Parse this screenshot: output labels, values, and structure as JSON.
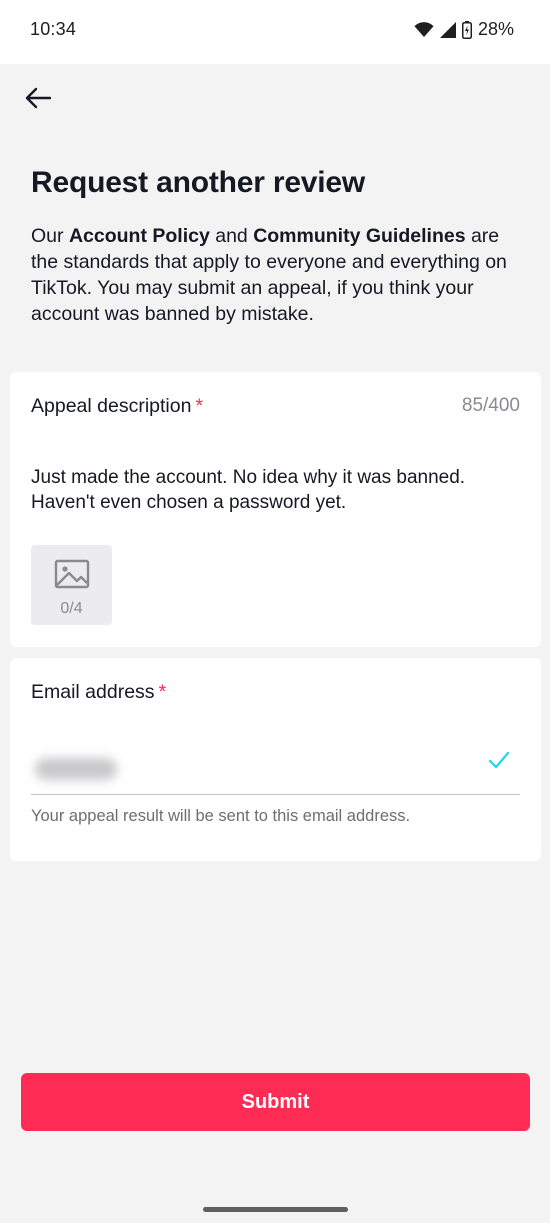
{
  "status_bar": {
    "time": "10:34",
    "battery": "28%",
    "icons": [
      "wifi-icon",
      "cellular-signal-icon",
      "battery-charging-icon"
    ]
  },
  "header": {
    "back_icon": "arrow-left-icon"
  },
  "page": {
    "title": "Request another review",
    "intro": {
      "part1": "Our ",
      "link1": "Account Policy",
      "part2": " and ",
      "link2": "Community Guidelines",
      "part3": " are the standards that apply to everyone and everything on TikTok. You may submit an appeal, if you think your account was banned by mistake."
    }
  },
  "appeal": {
    "label": "Appeal description",
    "required_marker": "*",
    "counter": "85/400",
    "text": "Just made the account. No idea why it was banned. Haven't even chosen a password yet.",
    "image_picker": {
      "icon": "image-icon",
      "count": "0/4"
    }
  },
  "email": {
    "label": "Email address",
    "required_marker": "*",
    "value_redacted": true,
    "valid_icon": "checkmark-icon",
    "helper": "Your appeal result will be sent to this email address."
  },
  "actions": {
    "submit_label": "Submit"
  },
  "colors": {
    "accent": "#fe2c55",
    "check": "#20d5ec",
    "background": "#f3f3f4"
  }
}
